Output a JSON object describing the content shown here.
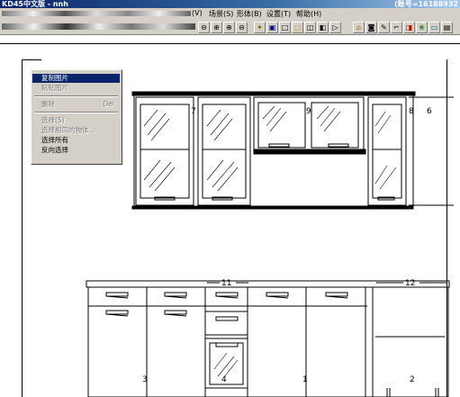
{
  "titlebar": {
    "title": "KD45中文版 - nnh",
    "id_label": "(账号=16188932"
  },
  "menubar": {
    "items": [
      "(V)",
      "场景(S)",
      "形体(B)",
      "设置(T)",
      "帮助(H)"
    ]
  },
  "toolbar": {
    "zoom_icons": [
      "⊖",
      "⊕",
      "⊕",
      "⊖"
    ]
  },
  "context_menu": {
    "items": [
      {
        "label": "复制图片",
        "state": "selected"
      },
      {
        "label": "粘贴图片",
        "state": "disabled"
      },
      {
        "label": "删除",
        "shortcut": "Del",
        "state": "disabled"
      },
      {
        "label": "选择(S)",
        "state": "disabled"
      },
      {
        "label": "选择相同的物体...",
        "state": "disabled"
      },
      {
        "label": "选择所有",
        "state": "normal"
      },
      {
        "label": "反向选择",
        "state": "normal"
      }
    ]
  },
  "drawing": {
    "upper_labels": [
      "7",
      "9",
      "8",
      "6"
    ],
    "lower_labels": [
      "11",
      "12",
      "3",
      "4",
      "1",
      "2"
    ]
  }
}
